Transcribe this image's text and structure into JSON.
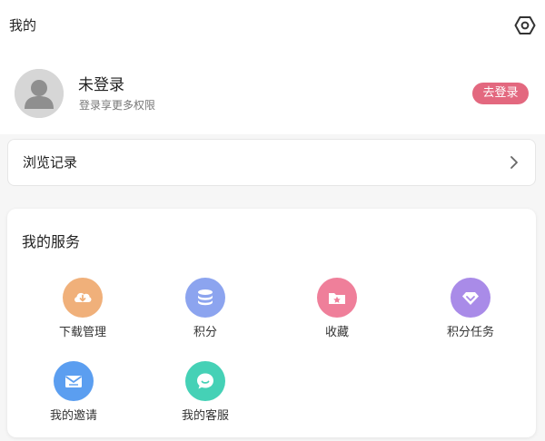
{
  "header": {
    "title": "我的",
    "settings_icon": "settings-hexagon-icon"
  },
  "profile": {
    "name": "未登录",
    "subtitle": "登录享更多权限",
    "login_label": "去登录",
    "avatar_icon": "default-avatar-icon",
    "login_color": "#e3687f"
  },
  "history": {
    "label": "浏览记录",
    "chevron_icon": "chevron-right-icon"
  },
  "services": {
    "title": "我的服务",
    "items": [
      {
        "label": "下载管理",
        "icon": "download-cloud-icon",
        "color": "#f0b07a"
      },
      {
        "label": "积分",
        "icon": "coins-stack-icon",
        "color": "#8ca4ef"
      },
      {
        "label": "收藏",
        "icon": "favorite-folder-icon",
        "color": "#ef7f9a"
      },
      {
        "label": "积分任务",
        "icon": "diamond-task-icon",
        "color": "#a98be8"
      },
      {
        "label": "我的邀请",
        "icon": "invite-envelope-icon",
        "color": "#5b9ef0"
      },
      {
        "label": "我的客服",
        "icon": "customer-service-chat-icon",
        "color": "#45d1b6"
      }
    ]
  }
}
